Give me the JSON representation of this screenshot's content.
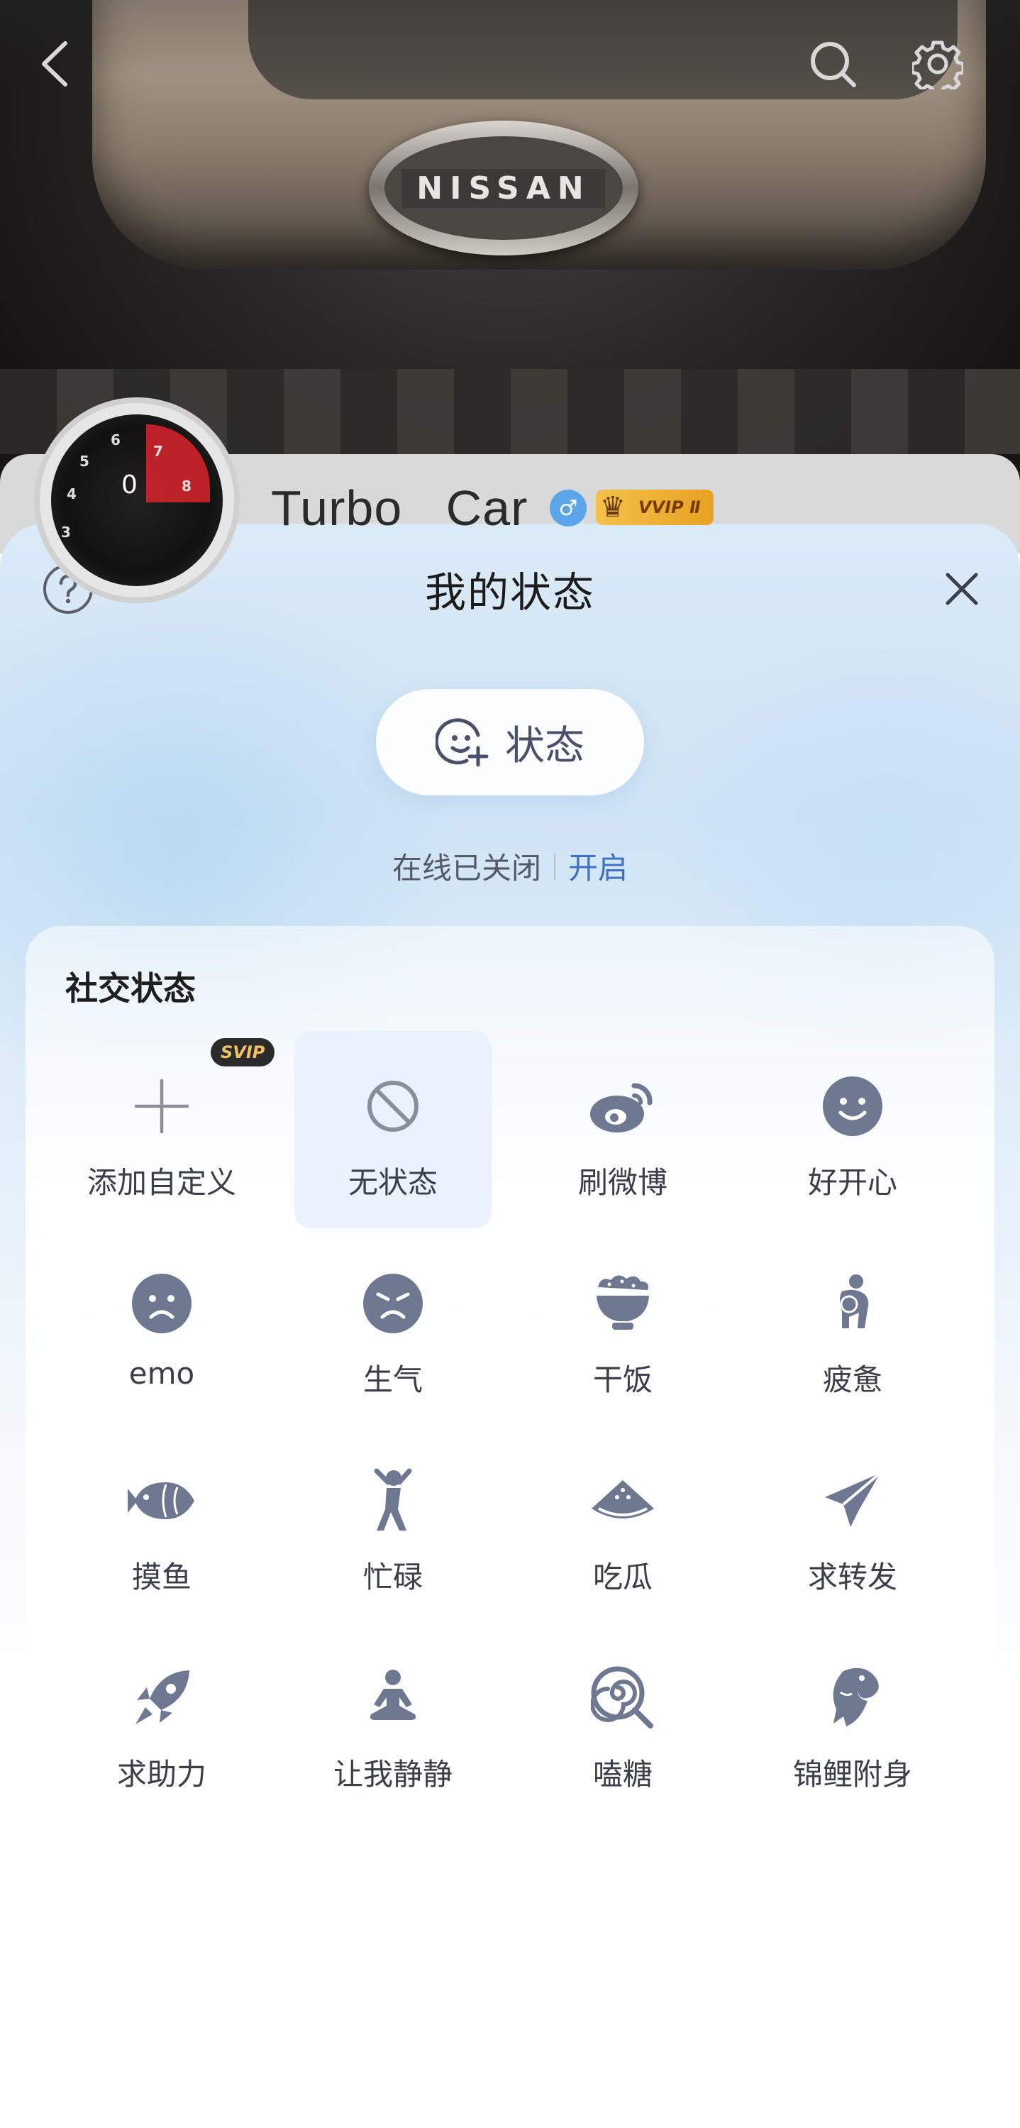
{
  "profile": {
    "name": "Turbo   Car",
    "gender_symbol": "♂",
    "vip_label": "VVIP Ⅱ",
    "cover_brand": "NISSAN",
    "avatar_numbers": [
      "6",
      "7",
      "5",
      "4",
      "8",
      "3"
    ],
    "avatar_speed": "0"
  },
  "topbar": {
    "back_icon": "chevron-left-icon",
    "search_icon": "search-icon",
    "settings_icon": "gear-icon"
  },
  "sheet": {
    "title": "我的状态",
    "help_icon": "help-circle-icon",
    "close_icon": "close-icon",
    "status_button_label": "状态",
    "online_status_text": "在线已关闭",
    "online_enable_link": "开启",
    "accent_color": "#3d6fc4"
  },
  "social": {
    "title": "社交状态",
    "svip_badge": "SVIP",
    "items": [
      {
        "label": "添加自定义",
        "icon": "plus-icon"
      },
      {
        "label": "无状态",
        "icon": "no-status-icon",
        "selected": true
      },
      {
        "label": "刷微博",
        "icon": "weibo-icon"
      },
      {
        "label": "好开心",
        "icon": "happy-face-icon"
      },
      {
        "label": "emo",
        "icon": "sad-face-icon"
      },
      {
        "label": "生气",
        "icon": "angry-face-icon"
      },
      {
        "label": "干饭",
        "icon": "rice-bowl-icon"
      },
      {
        "label": "疲惫",
        "icon": "tired-person-icon"
      },
      {
        "label": "摸鱼",
        "icon": "fish-icon"
      },
      {
        "label": "忙碌",
        "icon": "busy-person-icon"
      },
      {
        "label": "吃瓜",
        "icon": "watermelon-icon"
      },
      {
        "label": "求转发",
        "icon": "paper-plane-icon"
      },
      {
        "label": "求助力",
        "icon": "rocket-icon"
      },
      {
        "label": "让我静静",
        "icon": "meditate-icon"
      },
      {
        "label": "嗑糖",
        "icon": "lollipop-icon"
      },
      {
        "label": "锦鲤附身",
        "icon": "koi-icon"
      }
    ]
  }
}
